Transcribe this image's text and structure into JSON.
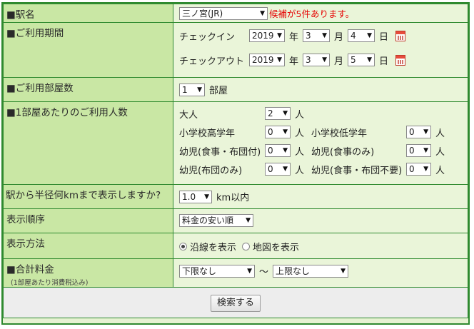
{
  "station": {
    "label": "■駅名",
    "select_value": "三ノ宮(JR)",
    "candidates_text": "候補が5件あります。"
  },
  "period": {
    "label": "■ご利用期間",
    "checkin": {
      "label": "チェックイン",
      "year": "2019",
      "month": "3",
      "day": "4"
    },
    "checkout": {
      "label": "チェックアウト",
      "year": "2019",
      "month": "3",
      "day": "5"
    },
    "unit_year": "年",
    "unit_month": "月",
    "unit_day": "日"
  },
  "rooms": {
    "label": "■ご利用部屋数",
    "value": "1",
    "unit": "部屋"
  },
  "people": {
    "label": "■1部屋あたりのご利用人数",
    "unit": "人",
    "adult": {
      "label": "大人",
      "value": "2"
    },
    "elem_upper": {
      "label": "小学校高学年",
      "value": "0"
    },
    "elem_lower": {
      "label": "小学校低学年",
      "value": "0"
    },
    "infant_meal_futon": {
      "label": "幼児(食事・布団付)",
      "value": "0"
    },
    "infant_meal": {
      "label": "幼児(食事のみ)",
      "value": "0"
    },
    "infant_futon": {
      "label": "幼児(布団のみ)",
      "value": "0"
    },
    "infant_none": {
      "label": "幼児(食事・布団不要)",
      "value": "0"
    }
  },
  "radius": {
    "label": "駅から半径何kmまで表示しますか?",
    "value": "1.0",
    "unit": "km以内"
  },
  "sort": {
    "label": "表示順序",
    "value": "料金の安い順"
  },
  "display": {
    "label": "表示方法",
    "opt_line": "沿線を表示",
    "opt_map": "地図を表示",
    "selected": "沿線を表示"
  },
  "price": {
    "label": "■合計料金",
    "note": "(1部屋あたり消費税込み)",
    "min_value": "下限なし",
    "separator": "～",
    "max_value": "上限なし"
  },
  "search_button": "検索する",
  "icons": {
    "dropdown": "triangle-down-icon",
    "calendar": "calendar-icon"
  }
}
